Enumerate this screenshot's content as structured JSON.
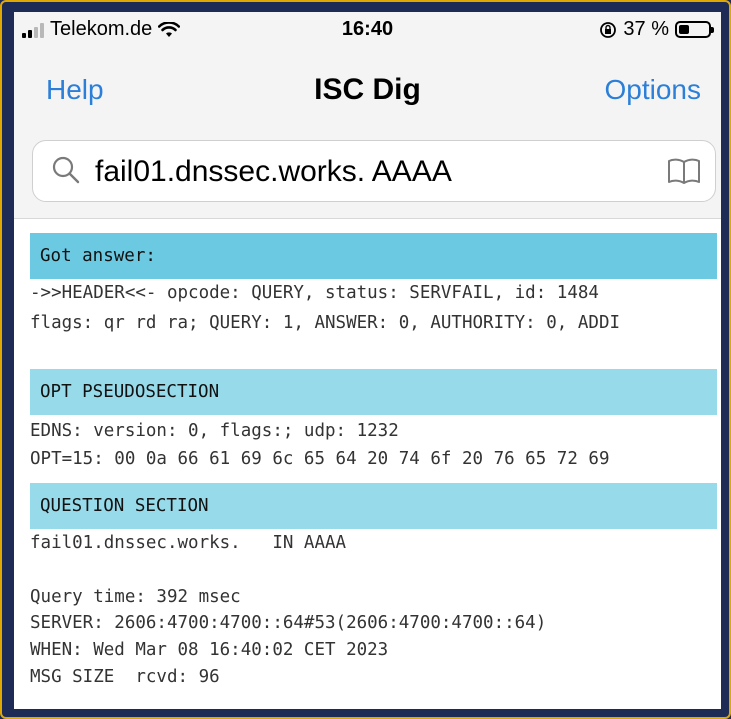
{
  "status_bar": {
    "carrier": "Telekom.de",
    "time": "16:40",
    "battery": "37 %",
    "battery_level": 0.37,
    "icons": [
      "signal-icon",
      "wifi-icon",
      "orientation-lock-icon",
      "battery-icon"
    ]
  },
  "nav": {
    "left": "Help",
    "title": "ISC Dig",
    "right": "Options",
    "accent": "#2b7fd8"
  },
  "search": {
    "value": "fail01.dnssec.works. AAAA",
    "icons": [
      "search-icon",
      "book-icon"
    ]
  },
  "colors": {
    "section_header": "#97dbea",
    "section_header_first": "#6cc9e2"
  },
  "output": {
    "header_section": {
      "title": "Got answer:",
      "lines": [
        "->>HEADER<<- opcode: QUERY, status: SERVFAIL, id: 1484",
        "flags: qr rd ra; QUERY: 1, ANSWER: 0, AUTHORITY: 0, ADDI"
      ]
    },
    "opt_section": {
      "title": "OPT PSEUDOSECTION",
      "lines": [
        "EDNS: version: 0, flags:; udp: 1232",
        "OPT=15: 00 0a 66 61 69 6c 65 64 20 74 6f 20 76 65 72 69"
      ]
    },
    "question_section": {
      "title": "QUESTION SECTION",
      "lines": [
        "fail01.dnssec.works.   IN AAAA"
      ]
    },
    "footer_lines": [
      "Query time: 392 msec",
      "SERVER: 2606:4700:4700::64#53(2606:4700:4700::64)",
      "WHEN: Wed Mar 08 16:40:02 CET 2023",
      "MSG SIZE  rcvd: 96"
    ]
  }
}
